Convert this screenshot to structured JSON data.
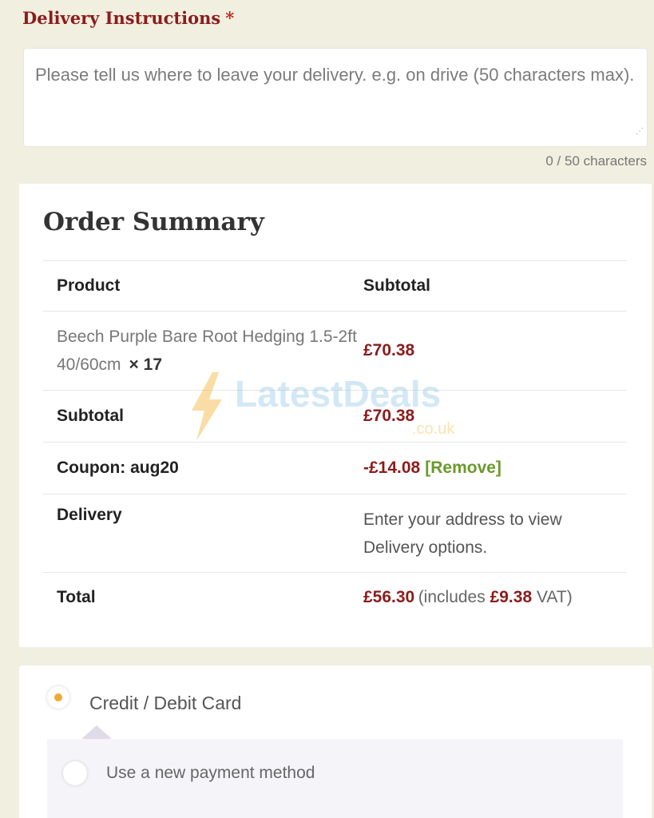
{
  "delivery": {
    "label": "Delivery Instructions",
    "required_mark": "*",
    "placeholder": "Please tell us where to leave your delivery. e.g. on drive (50 characters max).",
    "char_count": "0 / 50 characters"
  },
  "order_summary": {
    "title": "Order Summary",
    "headers": {
      "product": "Product",
      "subtotal": "Subtotal"
    },
    "item": {
      "name": "Beech Purple Bare Root Hedging 1.5-2ft 40/60cm",
      "qty": "× 17",
      "price": "£70.38"
    },
    "subtotal": {
      "label": "Subtotal",
      "value": "£70.38"
    },
    "coupon": {
      "label": "Coupon: aug20",
      "minus": "-",
      "value": "£14.08",
      "remove": "[Remove]"
    },
    "delivery": {
      "label": "Delivery",
      "value": "Enter your address to view Delivery options."
    },
    "total": {
      "label": "Total",
      "value": "£56.30",
      "incl_prefix": "(includes",
      "vat_value": "£9.38",
      "incl_suffix": "VAT)"
    }
  },
  "payment": {
    "card_label": "Credit / Debit Card",
    "new_method_label": "Use a new payment method"
  },
  "watermark": {
    "brand": "LatestDeals",
    "domain": ".co.uk"
  },
  "colors": {
    "background": "#f1efe0",
    "accent_red": "#8d1b1b",
    "remove_green": "#6a9a2c",
    "radio_orange": "#f0a92d"
  }
}
